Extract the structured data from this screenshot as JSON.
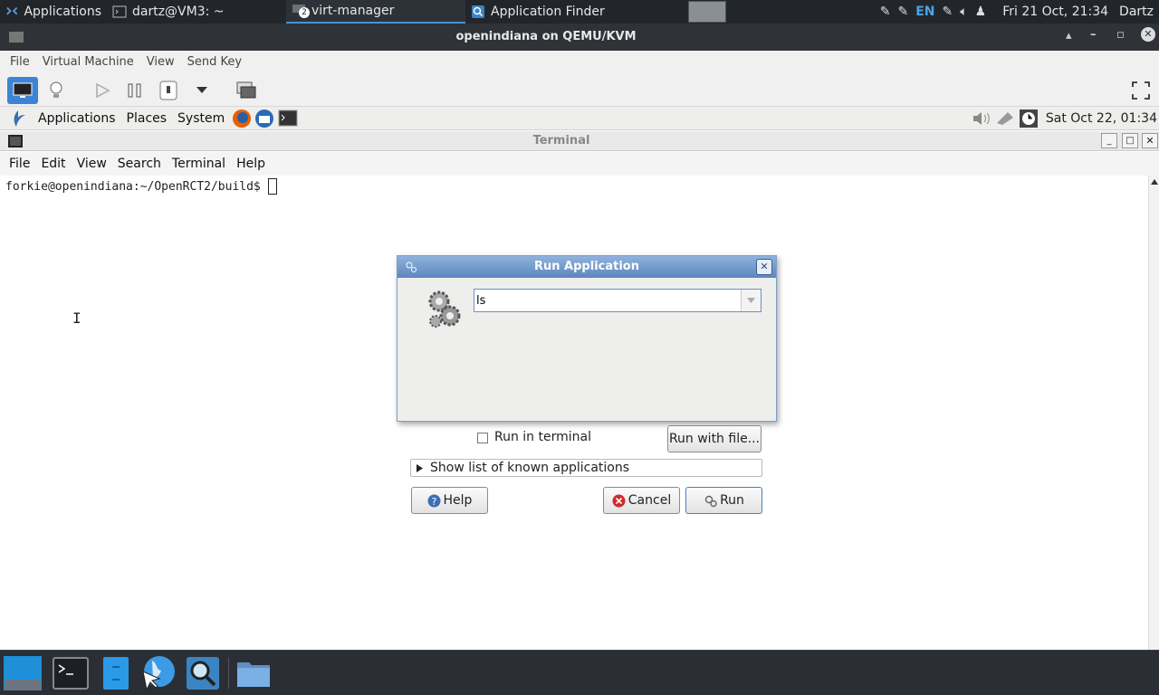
{
  "host_panel": {
    "applications": "Applications",
    "tasks": [
      {
        "label": "dartz@VM3: ~"
      },
      {
        "label": "virt-manager",
        "badge": "2"
      },
      {
        "label": "Application Finder"
      }
    ],
    "keyboard_layout": "EN",
    "clock": "Fri 21 Oct, 21:34",
    "user": "Dartz"
  },
  "vm_window": {
    "title": "openindiana on QEMU/KVM",
    "menu": [
      "File",
      "Virtual Machine",
      "View",
      "Send Key"
    ]
  },
  "guest_panel": {
    "menus": [
      "Applications",
      "Places",
      "System"
    ],
    "clock": "Sat Oct 22, 01:34"
  },
  "terminal": {
    "title": "Terminal",
    "menu": [
      "File",
      "Edit",
      "View",
      "Search",
      "Terminal",
      "Help"
    ],
    "prompt": "forkie@openindiana:~/OpenRCT2/build$ "
  },
  "run_dialog": {
    "title": "Run Application",
    "command_value": "ls",
    "run_in_terminal_label": "Run in terminal",
    "run_in_terminal_checked": false,
    "run_with_file_label": "Run with file...",
    "known_apps_label": "Show list of known applications",
    "help_label": "Help",
    "cancel_label": "Cancel",
    "run_label": "Run"
  },
  "colors": {
    "host_panel_bg": "#22262b",
    "dialog_title": "#5d86bd",
    "accent": "#4a90d9"
  }
}
